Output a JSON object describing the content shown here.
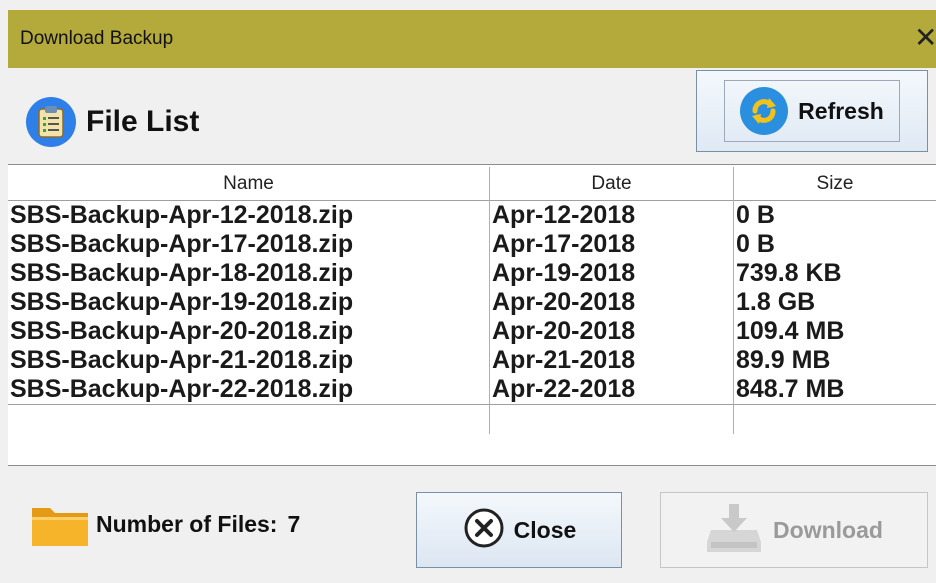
{
  "window": {
    "title": "Download Backup",
    "close_glyph": "✕"
  },
  "header": {
    "title": "File List",
    "icon": "clipboard-icon"
  },
  "toolbar": {
    "refresh_label": "Refresh",
    "refresh_icon": "refresh-icon"
  },
  "table": {
    "columns": [
      "Name",
      "Date",
      "Size"
    ],
    "rows": [
      {
        "name": "SBS-Backup-Apr-12-2018.zip",
        "date": "Apr-12-2018",
        "size": "0 B"
      },
      {
        "name": "SBS-Backup-Apr-17-2018.zip",
        "date": "Apr-17-2018",
        "size": "0 B"
      },
      {
        "name": "SBS-Backup-Apr-18-2018.zip",
        "date": "Apr-19-2018",
        "size": "739.8 KB"
      },
      {
        "name": "SBS-Backup-Apr-19-2018.zip",
        "date": "Apr-20-2018",
        "size": "1.8 GB"
      },
      {
        "name": "SBS-Backup-Apr-20-2018.zip",
        "date": "Apr-20-2018",
        "size": "109.4 MB"
      },
      {
        "name": "SBS-Backup-Apr-21-2018.zip",
        "date": "Apr-21-2018",
        "size": "89.9 MB"
      },
      {
        "name": "SBS-Backup-Apr-22-2018.zip",
        "date": "Apr-22-2018",
        "size": "848.7 MB"
      }
    ]
  },
  "footer": {
    "count_label": "Number of Files:",
    "count_value": "7",
    "close_label": "Close",
    "download_label": "Download"
  },
  "colors": {
    "titlebar": "#b4aa3c",
    "accent_blue": "#2f7fe8",
    "folder": "#f0a820"
  }
}
